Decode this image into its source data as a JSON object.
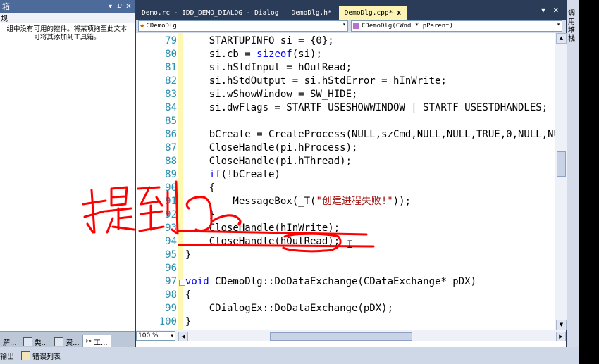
{
  "toolbox": {
    "title": "箱",
    "pin": "▾ ₽ ✕",
    "category": "规",
    "message_line1": "组中没有可用的控件。将某项拖至此文本",
    "message_line2": "可将其添加到工具箱。",
    "tabs": [
      {
        "label": "解..."
      },
      {
        "label": "类..."
      },
      {
        "label": "资..."
      },
      {
        "label": "工..."
      }
    ]
  },
  "status_bar": {
    "items": [
      {
        "label": "输出"
      },
      {
        "label": "错误列表"
      }
    ]
  },
  "document_tabs": [
    {
      "label": "Demo.rc - IDD_DEMO_DIALOG - Dialog",
      "active": false
    },
    {
      "label": "DemoDlg.h*",
      "active": false
    },
    {
      "label": "DemoDlg.cpp*",
      "active": true,
      "close": "x"
    }
  ],
  "tabs_controls": "▾ ✕",
  "nav": {
    "class_combo": "CDemoDlg",
    "method_combo": "CDemoDlg(CWnd * pParent)"
  },
  "editor": {
    "lines": [
      {
        "n": "79",
        "text": "    STARTUPINFO si = {0};"
      },
      {
        "n": "80",
        "pre": "    si.cb = ",
        "kw": "sizeof",
        "post": "(si);"
      },
      {
        "n": "81",
        "text": "    si.hStdInput = hOutRead;"
      },
      {
        "n": "82",
        "text": "    si.hStdOutput = si.hStdError = hInWrite;"
      },
      {
        "n": "83",
        "text": "    si.wShowWindow = SW_HIDE;"
      },
      {
        "n": "84",
        "text": "    si.dwFlags = STARTF_USESHOWWINDOW | STARTF_USESTDHANDLES;"
      },
      {
        "n": "85",
        "text": ""
      },
      {
        "n": "86",
        "text": "    bCreate = CreateProcess(NULL,szCmd,NULL,NULL,TRUE,0,NULL,NU"
      },
      {
        "n": "87",
        "text": "    CloseHandle(pi.hProcess);"
      },
      {
        "n": "88",
        "text": "    CloseHandle(pi.hThread);"
      },
      {
        "n": "89",
        "kw": "if",
        "pre": "    ",
        "post": "(!bCreate)"
      },
      {
        "n": "90",
        "text": "    {"
      },
      {
        "n": "91",
        "pre": "        MessageBox(_T(",
        "str": "\"创建进程失败!\"",
        "post": "));"
      },
      {
        "n": "92",
        "text": "    }"
      },
      {
        "n": "93",
        "text": "    CloseHandle(hInWrite);"
      },
      {
        "n": "94",
        "text": "    CloseHandle(hOutRead);"
      },
      {
        "n": "95",
        "text": "}"
      },
      {
        "n": "96",
        "text": ""
      },
      {
        "n": "97",
        "kw": "void",
        "pre": "",
        "post": " CDemoDlg::DoDataExchange(CDataExchange* pDX)"
      },
      {
        "n": "98",
        "text": "{"
      },
      {
        "n": "99",
        "text": "    CDialogEx::DoDataExchange(pDX);"
      },
      {
        "n": "100",
        "text": "}"
      }
    ]
  },
  "zoom": "100 %",
  "right_panel_label": "调\n用\n堆\n栈",
  "colors": {
    "line_number": "#2b91af",
    "keyword": "#0000ff",
    "string": "#a31515",
    "annotation_red": "#ff0000",
    "active_tab": "#fcf3b5",
    "frame": "#2b3c59"
  }
}
